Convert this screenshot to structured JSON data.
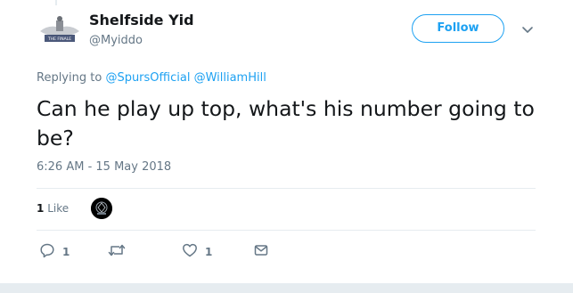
{
  "author": {
    "name": "Shelfside Yid",
    "handle": "@Myiddo",
    "avatar_text": "THE FINALE"
  },
  "follow_label": "Follow",
  "reply_context": {
    "prefix": "Replying to",
    "mentions": [
      "@SpursOfficial",
      "@WilliamHill"
    ]
  },
  "tweet_text": "Can he play up top, what's his number going to be?",
  "timestamp": "6:26 AM - 15 May 2018",
  "stats": {
    "likes_count": "1",
    "likes_label": "Like"
  },
  "actions": {
    "reply_count": "1",
    "retweet_count": "",
    "like_count": "1"
  },
  "icons": {
    "caret": "chevron-down-icon",
    "reply": "reply-icon",
    "retweet": "retweet-icon",
    "like": "heart-icon",
    "dm": "envelope-icon"
  },
  "colors": {
    "brand": "#1da1f2",
    "text": "#14171a",
    "muted": "#657786",
    "divider": "#e6ecf0"
  }
}
